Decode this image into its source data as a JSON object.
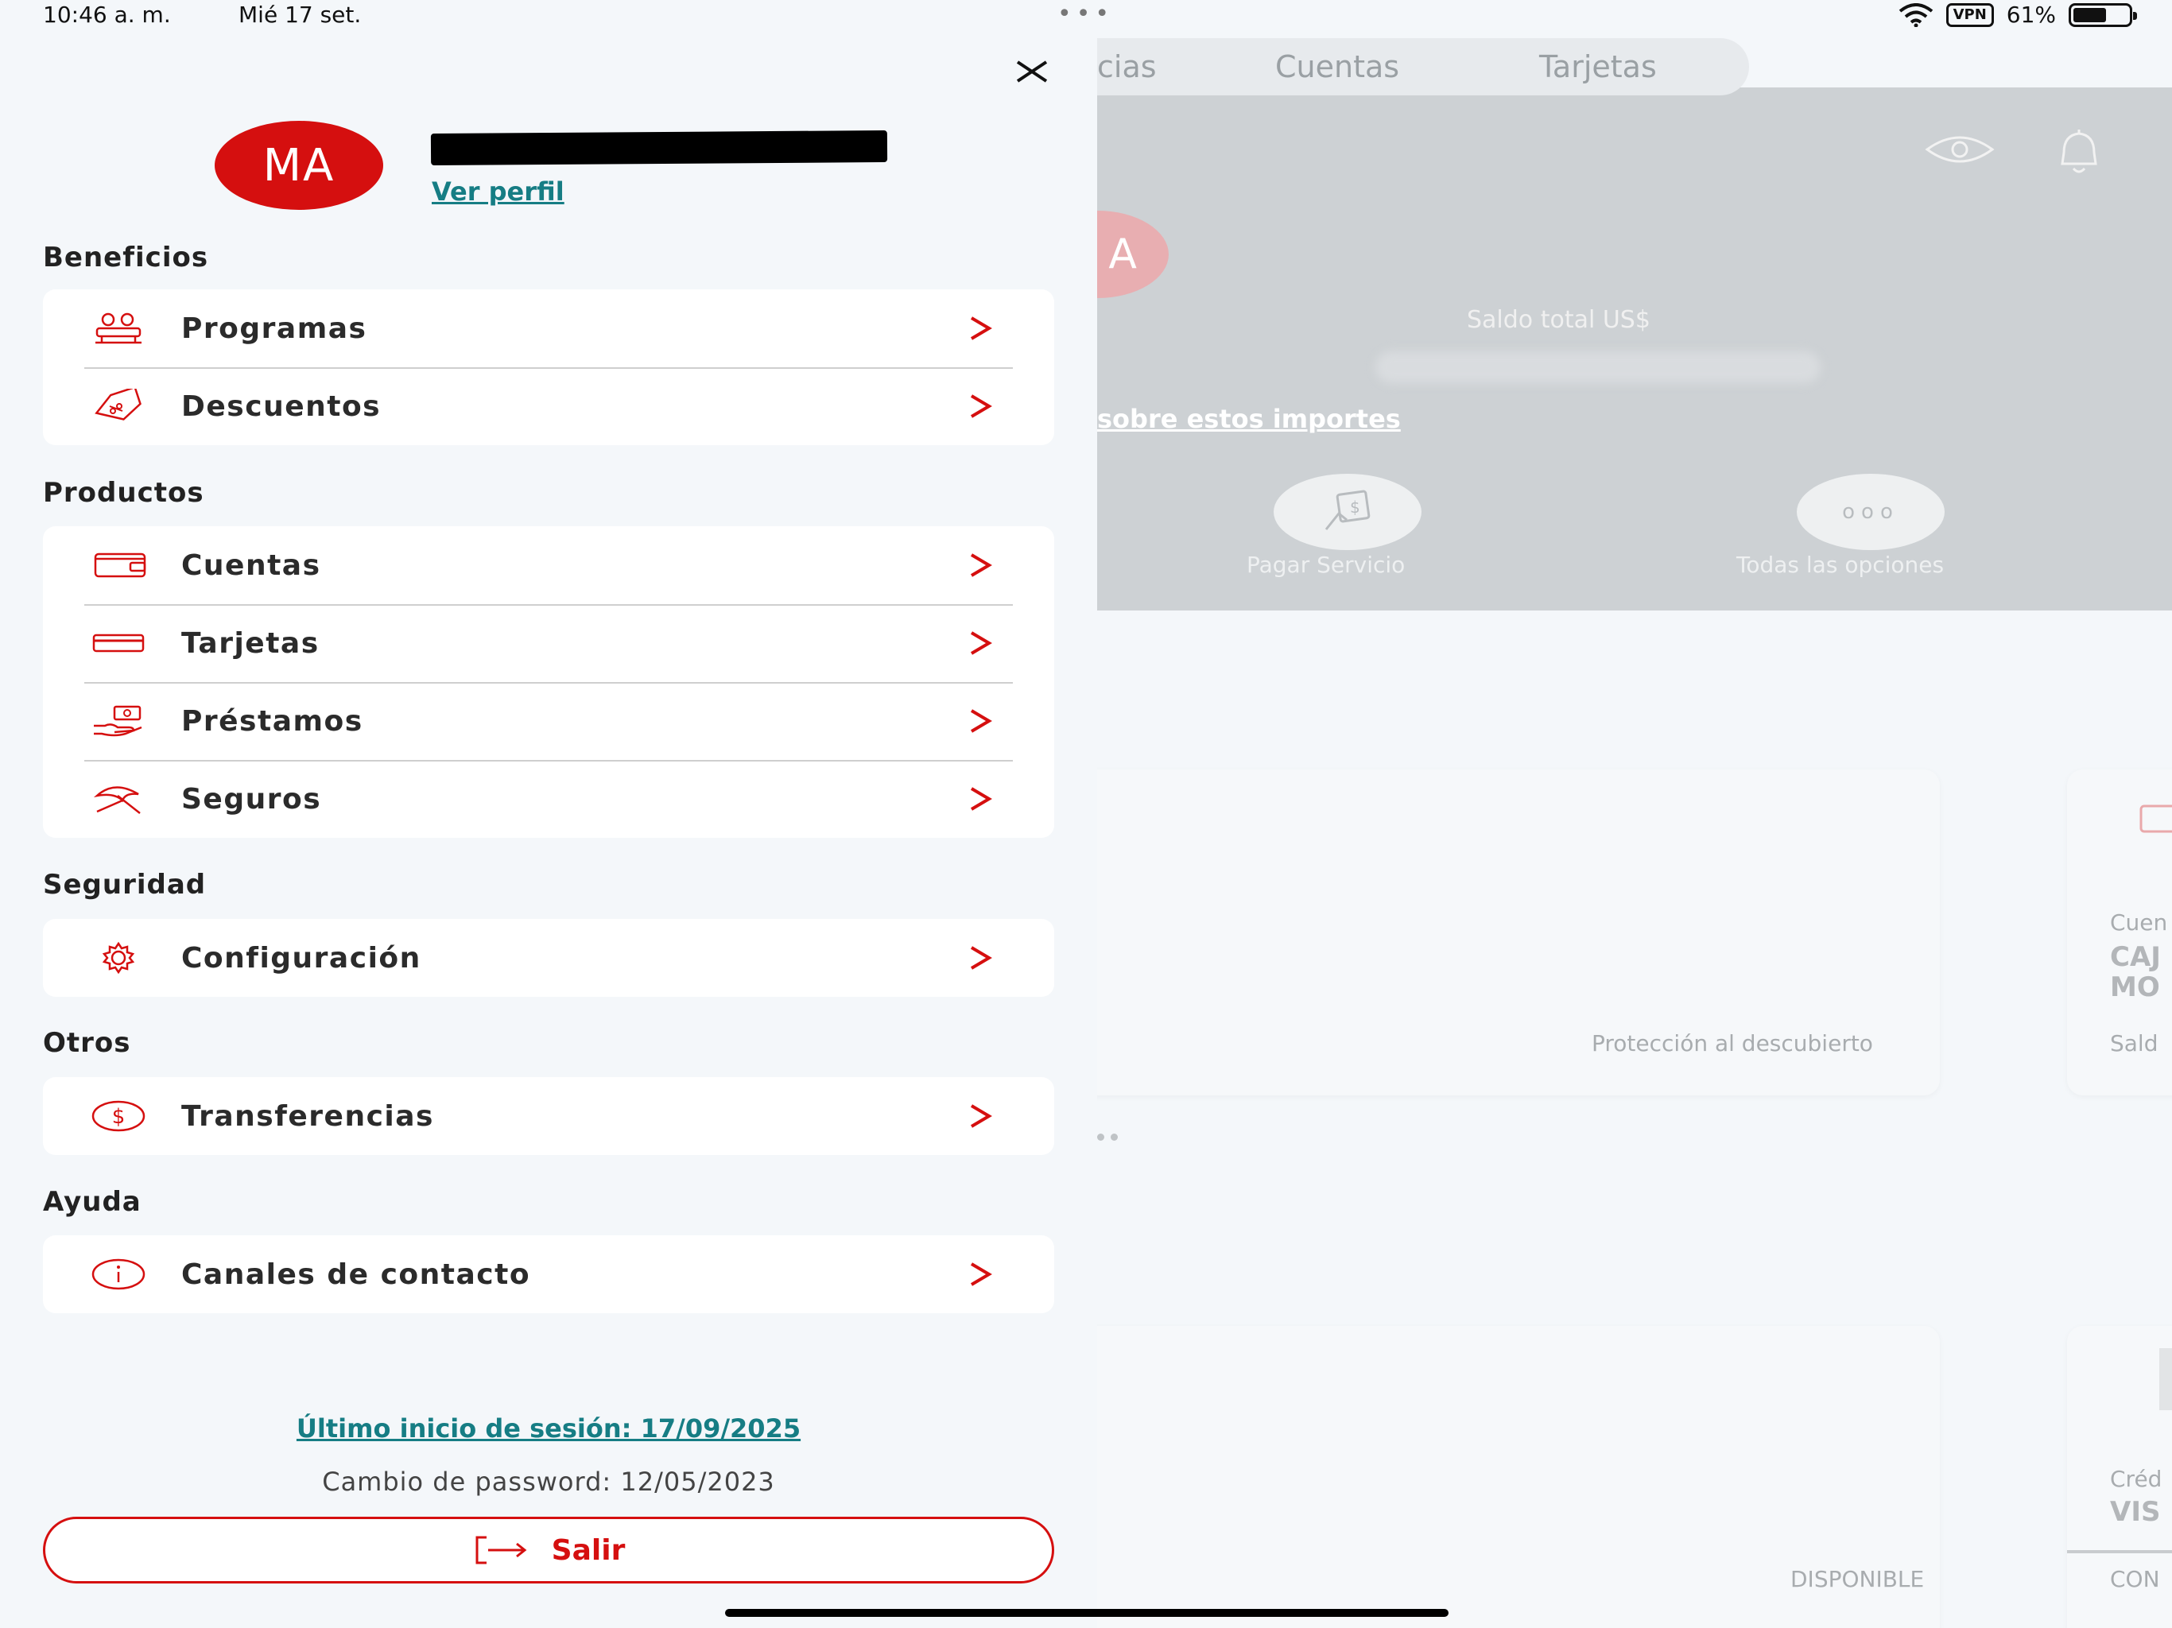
{
  "status_bar": {
    "time": "10:46 a. m.",
    "date": "Mié 17 set.",
    "vpn": "VPN",
    "battery": "61%",
    "battery_level": 0.61
  },
  "drawer": {
    "avatar_initials": "MA",
    "view_profile": "Ver perfil",
    "sections": [
      {
        "title": "Beneficios",
        "items": [
          {
            "label": "Programas",
            "icon": "people-icon"
          },
          {
            "label": "Descuentos",
            "icon": "discount-tag-icon"
          }
        ]
      },
      {
        "title": "Productos",
        "items": [
          {
            "label": "Cuentas",
            "icon": "wallet-icon"
          },
          {
            "label": "Tarjetas",
            "icon": "card-icon"
          },
          {
            "label": "Préstamos",
            "icon": "loan-hand-icon"
          },
          {
            "label": "Seguros",
            "icon": "umbrella-icon"
          }
        ]
      },
      {
        "title": "Seguridad",
        "items": [
          {
            "label": "Configuración",
            "icon": "gear-icon"
          }
        ]
      },
      {
        "title": "Otros",
        "items": [
          {
            "label": "Transferencias",
            "icon": "dollar-icon"
          }
        ]
      },
      {
        "title": "Ayuda",
        "items": [
          {
            "label": "Canales de contacto",
            "icon": "info-icon"
          }
        ]
      }
    ],
    "last_login": "Último inicio de sesión: 17/09/2025",
    "password_change": "Cambio de password: 12/05/2023",
    "logout": "Salir"
  },
  "background": {
    "tabs": [
      "cias",
      "Cuentas",
      "Tarjetas"
    ],
    "avatar_initial": "A",
    "balance_label": "Saldo total US$",
    "info_link": "sobre estos importes",
    "quick_actions": [
      "Pagar Servicio",
      "Todas las opciones"
    ],
    "card1_label": "Protección al descubierto",
    "card2_lines": [
      "Cuen",
      "CAJ",
      "MO",
      "Sald"
    ],
    "card3_label": "DISPONIBLE",
    "card4_lines": [
      "Créd",
      "VIS",
      "CON"
    ]
  },
  "colors": {
    "accent_red": "#d50f0f",
    "link_teal": "#167d84"
  }
}
